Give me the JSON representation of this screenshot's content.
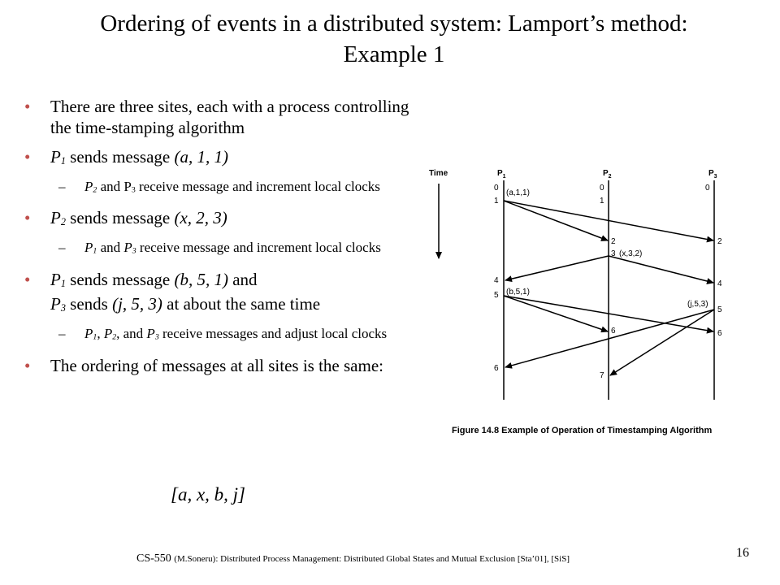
{
  "slide": {
    "title_line1": "Ordering of events in a distributed system: Lamport’s method:",
    "title_line2": "Example 1",
    "page_number": "16"
  },
  "bullets": {
    "b1": "There are three sites, each with a process controlling the time-stamping algorithm",
    "b2": {
      "p": "P",
      "sub": "1",
      "text": " sends message ",
      "msg": "(a, 1, 1)"
    },
    "b2_sub": {
      "p2": "P",
      "sub2": "2",
      "and": " and P",
      "sub3": "3",
      "rest": " receive message and increment local clocks"
    },
    "b3": {
      "p": "P",
      "sub": "2",
      "text": " sends message ",
      "msg": "(x, 2, 3)"
    },
    "b3_sub": {
      "p1": "P",
      "sub1": "1",
      "and": " and ",
      "p3": "P",
      "sub3": "3",
      "rest": " receive message and increment local clocks"
    },
    "b4": {
      "p1": "P",
      "sub1": "1",
      "t1": " sends message ",
      "m1": "(b, 5, 1)",
      "t2": " and",
      "p3": "P",
      "sub3": "3",
      "t3": " sends ",
      "m2": "(j, 5, 3)",
      "t4": " at about the same time"
    },
    "b4_sub": {
      "p1": "P",
      "sub1": "1",
      "c1": ", ",
      "p2": "P",
      "sub2": "2",
      "c2": ", and ",
      "p3": "P",
      "sub3": "3",
      "rest": " receive messages and adjust local clocks"
    },
    "b5": "The ordering of messages at all sites is the same:",
    "final": "[a, x, b, j]"
  },
  "footer": {
    "course": "CS-550 ",
    "detail": "(M.Soneru): Distributed Process Management: Distributed Global States and Mutual Exclusion [Sta’01], [SiS]"
  },
  "figure": {
    "time_label": "Time",
    "p1": "P",
    "p1_sub": "1",
    "p2": "P",
    "p2_sub": "2",
    "p3": "P",
    "p3_sub": "3",
    "caption": "Figure 14.8  Example of Operation of Timestamping Algorithm",
    "p1_clocks": {
      "c0": "0",
      "c1": "1",
      "c4": "4",
      "c5": "5",
      "c6": "6"
    },
    "p2_clocks": {
      "c0": "0",
      "c1": "1",
      "c2": "2",
      "c3": "3",
      "c6": "6",
      "c7": "7"
    },
    "p3_clocks": {
      "c0": "0",
      "c2": "2",
      "c4": "4",
      "c5": "5",
      "c6": "6"
    },
    "messages": {
      "a": "(a,1,1)",
      "x": "(x,3,2)",
      "b": "(b,5,1)",
      "j": "(j,5,3)"
    }
  }
}
